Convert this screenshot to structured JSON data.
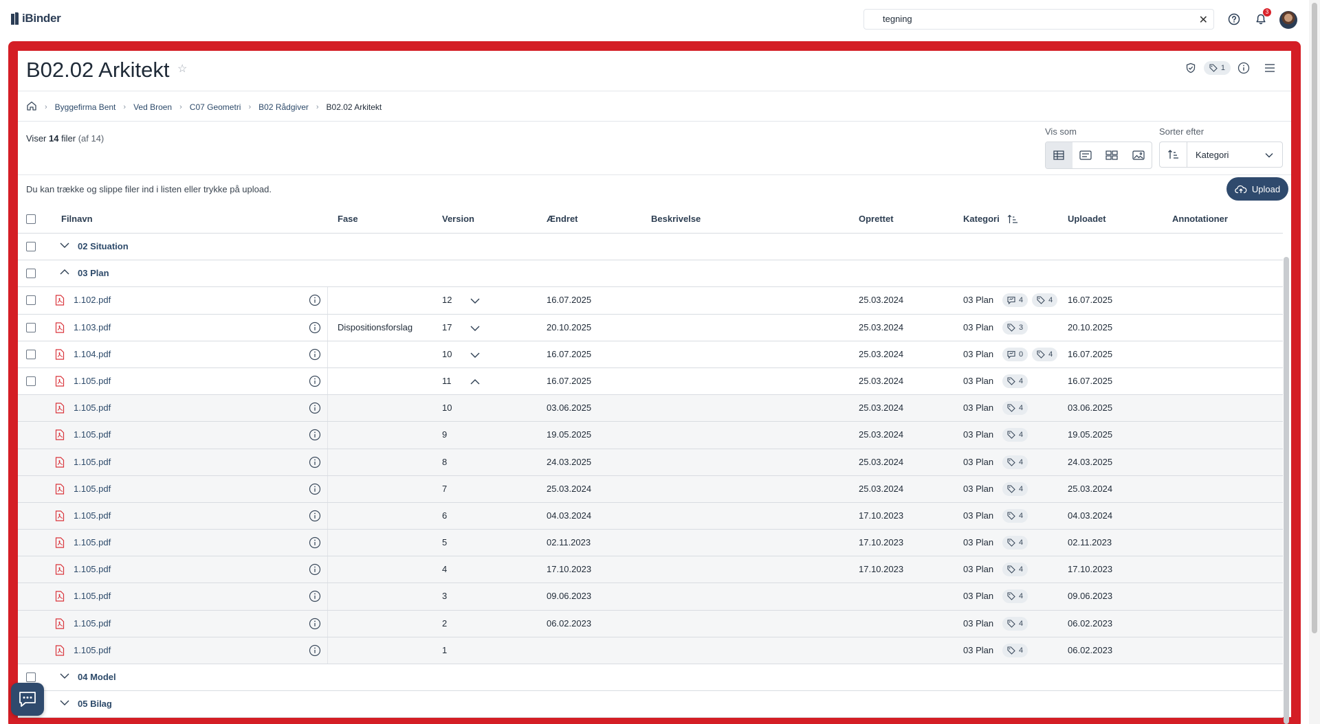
{
  "app": {
    "name": "iBinder"
  },
  "topbar": {
    "search_value": "tegning",
    "notifications_count": "3",
    "icons": [
      "help-icon",
      "bell-icon",
      "avatar"
    ]
  },
  "page": {
    "title": "B02.02 Arkitekt",
    "tag_count": "1"
  },
  "breadcrumb": [
    "Byggefirma Bent",
    "Ved Broen",
    "C07 Geometri",
    "B02 Rådgiver",
    "B02.02 Arkitekt"
  ],
  "summary": {
    "prefix": "Viser",
    "shown": "14",
    "unit": "filer",
    "total": "(af 14)"
  },
  "view": {
    "label": "Vis som",
    "options": [
      "table-icon",
      "list-icon",
      "grid-icon",
      "image-icon"
    ],
    "active": "table-icon"
  },
  "sort": {
    "label": "Sorter efter",
    "value": "Kategori"
  },
  "dropzone_text": "Du kan trække og slippe filer ind i listen eller trykke på upload.",
  "upload_label": "Upload",
  "columns": {
    "filnavn": "Filnavn",
    "fase": "Fase",
    "version": "Version",
    "aendret": "Ændret",
    "beskrivelse": "Beskrivelse",
    "oprettet": "Oprettet",
    "kategori": "Kategori",
    "uploadet": "Uploadet",
    "annotationer": "Annotationer"
  },
  "groups": {
    "g02": "02 Situation",
    "g03": "03 Plan",
    "g04": "04 Model",
    "g05": "05 Bilag"
  },
  "rows": [
    {
      "name": "1.102.pdf",
      "fase": "",
      "version": "12",
      "aendret": "16.07.2025",
      "oprettet": "25.03.2024",
      "kategori": "03 Plan",
      "uploadet": "16.07.2025",
      "comments": "4",
      "tags": "4"
    },
    {
      "name": "1.103.pdf",
      "fase": "Dispositionsforslag",
      "version": "17",
      "aendret": "20.10.2025",
      "oprettet": "25.03.2024",
      "kategori": "03 Plan",
      "uploadet": "20.10.2025",
      "tags": "3"
    },
    {
      "name": "1.104.pdf",
      "fase": "",
      "version": "10",
      "aendret": "16.07.2025",
      "oprettet": "25.03.2024",
      "kategori": "03 Plan",
      "uploadet": "16.07.2025",
      "comments": "0",
      "tags": "4"
    },
    {
      "name": "1.105.pdf",
      "fase": "",
      "version": "11",
      "aendret": "16.07.2025",
      "oprettet": "25.03.2024",
      "kategori": "03 Plan",
      "uploadet": "16.07.2025",
      "tags": "4"
    }
  ],
  "versions": [
    {
      "name": "1.105.pdf",
      "version": "10",
      "aendret": "03.06.2025",
      "oprettet": "25.03.2024",
      "kategori": "03 Plan",
      "uploadet": "03.06.2025",
      "tags": "4"
    },
    {
      "name": "1.105.pdf",
      "version": "9",
      "aendret": "19.05.2025",
      "oprettet": "25.03.2024",
      "kategori": "03 Plan",
      "uploadet": "19.05.2025",
      "tags": "4"
    },
    {
      "name": "1.105.pdf",
      "version": "8",
      "aendret": "24.03.2025",
      "oprettet": "25.03.2024",
      "kategori": "03 Plan",
      "uploadet": "24.03.2025",
      "tags": "4"
    },
    {
      "name": "1.105.pdf",
      "version": "7",
      "aendret": "25.03.2024",
      "oprettet": "25.03.2024",
      "kategori": "03 Plan",
      "uploadet": "25.03.2024",
      "tags": "4"
    },
    {
      "name": "1.105.pdf",
      "version": "6",
      "aendret": "04.03.2024",
      "oprettet": "17.10.2023",
      "kategori": "03 Plan",
      "uploadet": "04.03.2024",
      "tags": "4"
    },
    {
      "name": "1.105.pdf",
      "version": "5",
      "aendret": "02.11.2023",
      "oprettet": "17.10.2023",
      "kategori": "03 Plan",
      "uploadet": "02.11.2023",
      "tags": "4"
    },
    {
      "name": "1.105.pdf",
      "version": "4",
      "aendret": "17.10.2023",
      "oprettet": "17.10.2023",
      "kategori": "03 Plan",
      "uploadet": "17.10.2023",
      "tags": "4"
    },
    {
      "name": "1.105.pdf",
      "version": "3",
      "aendret": "09.06.2023",
      "oprettet": "",
      "kategori": "03 Plan",
      "uploadet": "09.06.2023",
      "tags": "4"
    },
    {
      "name": "1.105.pdf",
      "version": "2",
      "aendret": "06.02.2023",
      "oprettet": "",
      "kategori": "03 Plan",
      "uploadet": "06.02.2023",
      "tags": "4"
    },
    {
      "name": "1.105.pdf",
      "version": "1",
      "aendret": "",
      "oprettet": "",
      "kategori": "03 Plan",
      "uploadet": "06.02.2023",
      "tags": "4"
    }
  ],
  "colors": {
    "frame": "#d41e25",
    "primary": "#2f4a6d",
    "pdf": "#d9333a"
  }
}
